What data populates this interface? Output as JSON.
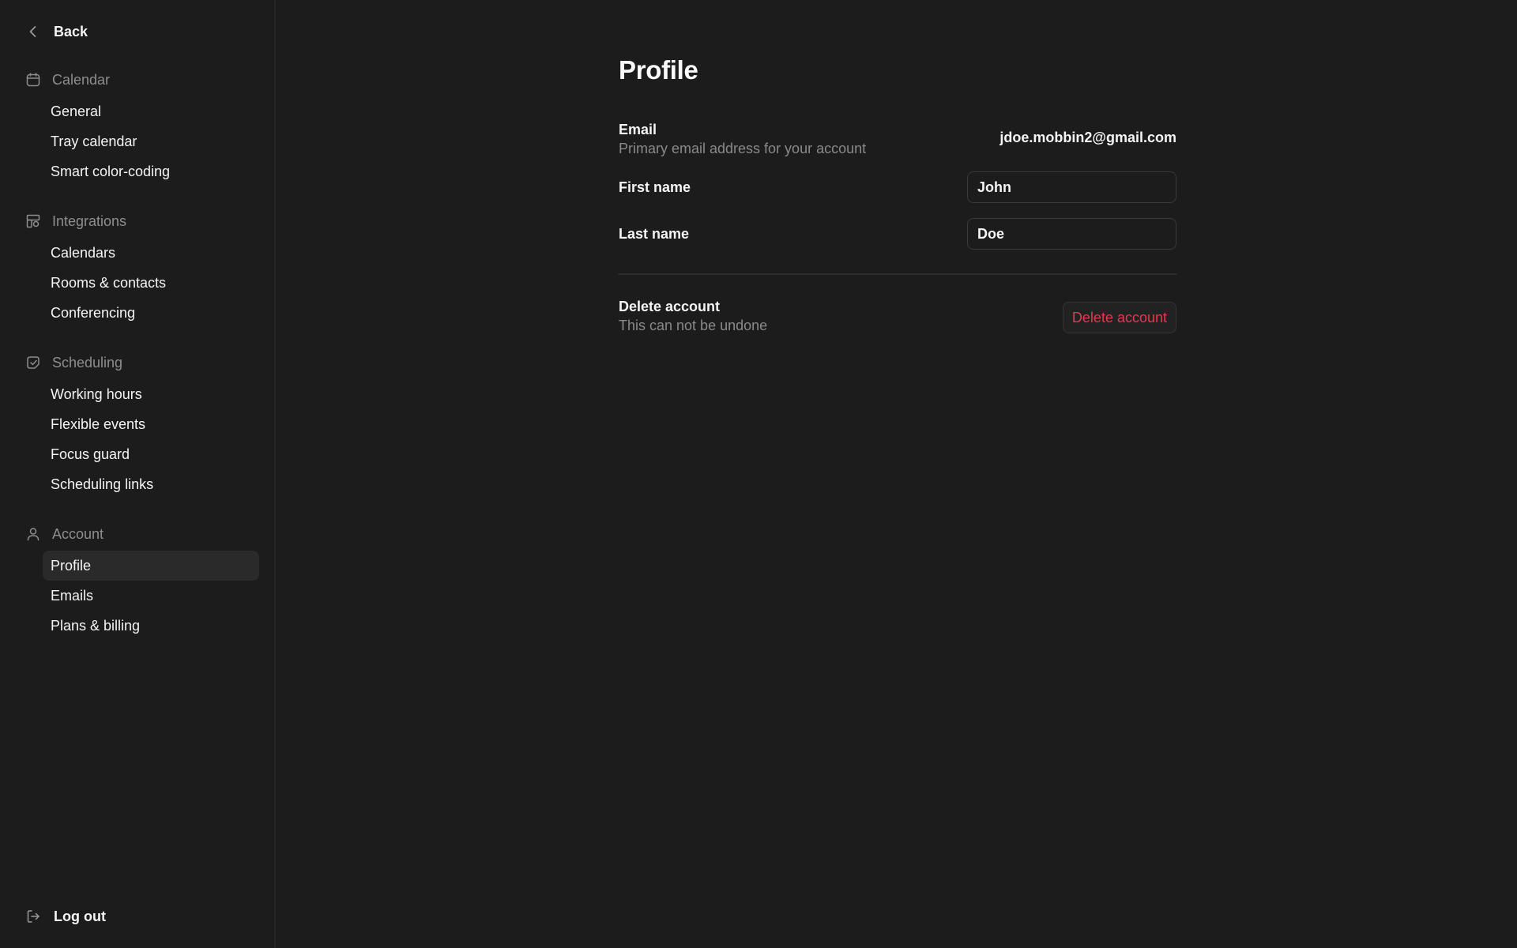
{
  "sidebar": {
    "back_label": "Back",
    "sections": [
      {
        "title": "Calendar",
        "icon": "calendar-icon",
        "items": [
          "General",
          "Tray calendar",
          "Smart color-coding"
        ]
      },
      {
        "title": "Integrations",
        "icon": "integrations-icon",
        "items": [
          "Calendars",
          "Rooms & contacts",
          "Conferencing"
        ]
      },
      {
        "title": "Scheduling",
        "icon": "scheduling-icon",
        "items": [
          "Working hours",
          "Flexible events",
          "Focus guard",
          "Scheduling links"
        ]
      },
      {
        "title": "Account",
        "icon": "user-icon",
        "items": [
          "Profile",
          "Emails",
          "Plans & billing"
        ]
      }
    ],
    "active_item": "Profile",
    "logout_label": "Log out"
  },
  "main": {
    "title": "Profile",
    "email": {
      "label": "Email",
      "description": "Primary email address for your account",
      "value": "jdoe.mobbin2@gmail.com"
    },
    "first_name": {
      "label": "First name",
      "value": "John"
    },
    "last_name": {
      "label": "Last name",
      "value": "Doe"
    },
    "delete": {
      "label": "Delete account",
      "description": "This can not be undone",
      "button_label": "Delete account"
    }
  },
  "colors": {
    "background": "#1c1c1c",
    "danger": "#e5394f",
    "muted_text": "#8a8a8a"
  }
}
